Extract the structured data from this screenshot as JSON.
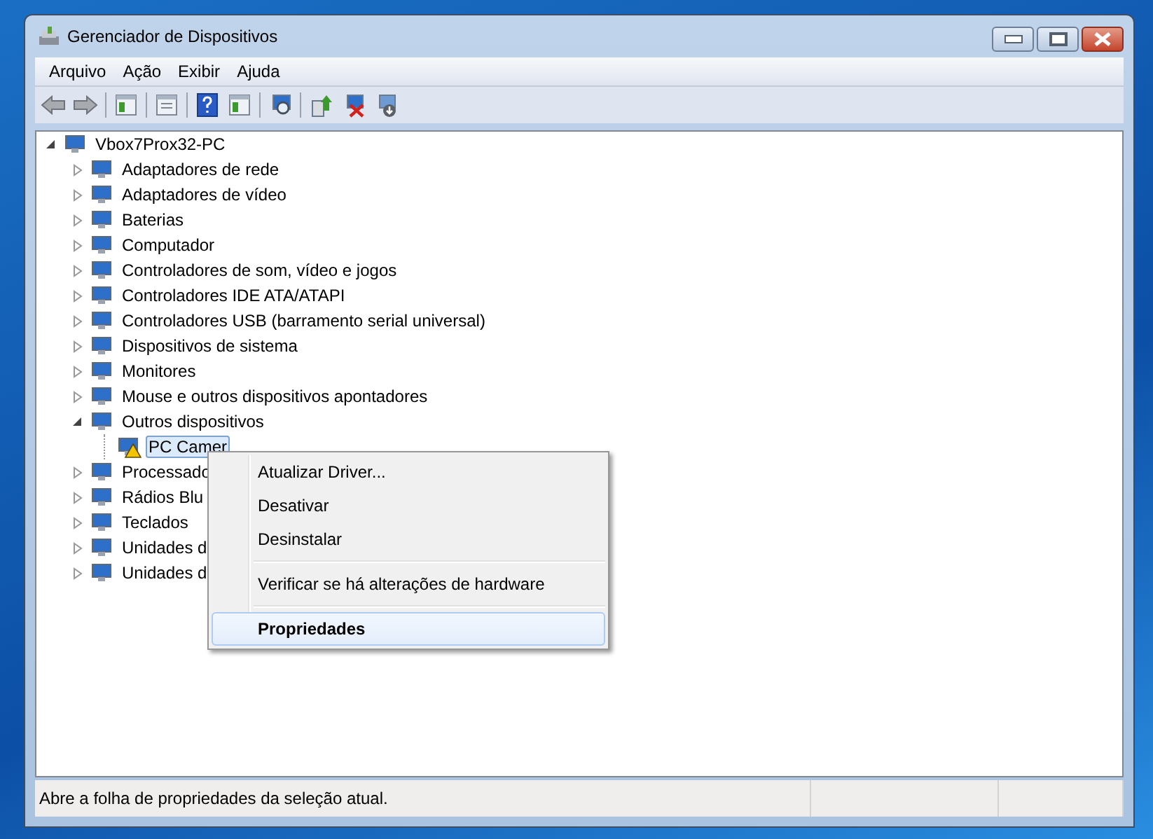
{
  "window": {
    "title": "Gerenciador de Dispositivos"
  },
  "menu_bar": [
    "Arquivo",
    "Ação",
    "Exibir",
    "Ajuda"
  ],
  "tree": {
    "label": "Vbox7Prox32-PC",
    "expanded": true,
    "children": [
      {
        "label": "Adaptadores de rede",
        "expanded": false
      },
      {
        "label": "Adaptadores de vídeo",
        "expanded": false
      },
      {
        "label": "Baterias",
        "expanded": false
      },
      {
        "label": "Computador",
        "expanded": false
      },
      {
        "label": "Controladores de som, vídeo e jogos",
        "expanded": false
      },
      {
        "label": "Controladores IDE ATA/ATAPI",
        "expanded": false
      },
      {
        "label": "Controladores USB (barramento serial universal)",
        "expanded": false
      },
      {
        "label": "Dispositivos de sistema",
        "expanded": false
      },
      {
        "label": "Monitores",
        "expanded": false
      },
      {
        "label": "Mouse e outros dispositivos apontadores",
        "expanded": false
      },
      {
        "label": "Outros dispositivos",
        "expanded": true,
        "children": [
          {
            "label": "PC Camer",
            "selected": true,
            "warning": true
          }
        ]
      },
      {
        "label": "Processado",
        "expanded": false
      },
      {
        "label": "Rádios Blu",
        "expanded": false
      },
      {
        "label": "Teclados",
        "expanded": false
      },
      {
        "label": "Unidades d",
        "expanded": false
      },
      {
        "label": "Unidades d",
        "expanded": false
      }
    ]
  },
  "context_menu": [
    {
      "kind": "item",
      "label": "Atualizar Driver...",
      "selected": false,
      "default": false
    },
    {
      "kind": "item",
      "label": "Desativar",
      "selected": false,
      "default": false
    },
    {
      "kind": "item",
      "label": "Desinstalar",
      "selected": false,
      "default": false
    },
    {
      "kind": "separator"
    },
    {
      "kind": "item",
      "label": "Verificar se há alterações de hardware",
      "selected": false,
      "default": false
    },
    {
      "kind": "separator"
    },
    {
      "kind": "item",
      "label": "Propriedades",
      "selected": true,
      "default": true
    }
  ],
  "status_bar": {
    "text": "Abre a folha de propriedades da seleção atual."
  }
}
